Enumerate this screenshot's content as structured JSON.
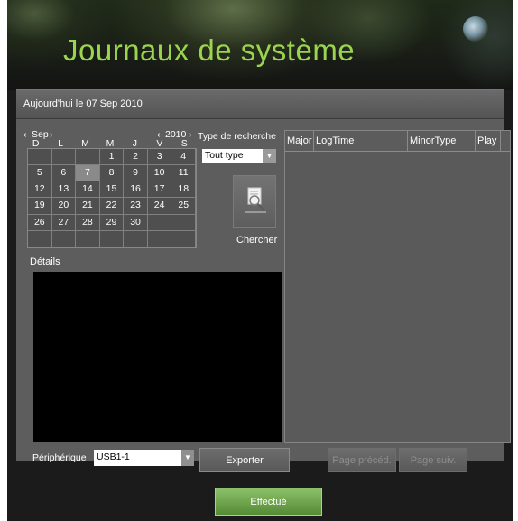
{
  "title": "Journaux de système",
  "date_bar": "Aujourd'hui le 07 Sep 2010",
  "calendar": {
    "month": "Sep",
    "year": "2010",
    "prev": "‹",
    "next": "›",
    "day_names": [
      "D",
      "L",
      "M",
      "M",
      "J",
      "V",
      "S"
    ],
    "weeks": [
      [
        "",
        "",
        "",
        "1",
        "2",
        "3",
        "4"
      ],
      [
        "5",
        "6",
        "7",
        "8",
        "9",
        "10",
        "11"
      ],
      [
        "12",
        "13",
        "14",
        "15",
        "16",
        "17",
        "18"
      ],
      [
        "19",
        "20",
        "21",
        "22",
        "23",
        "24",
        "25"
      ],
      [
        "26",
        "27",
        "28",
        "29",
        "30",
        "",
        ""
      ],
      [
        "",
        "",
        "",
        "",
        "",
        "",
        ""
      ]
    ],
    "selected_day": "7"
  },
  "search": {
    "type_label": "Type de recherche",
    "type_value": "Tout type",
    "button_label": "Chercher",
    "icon": "search-icon"
  },
  "details_label": "Détails",
  "log_table": {
    "columns": [
      "Major",
      "LogTime",
      "MinorType",
      "Play"
    ]
  },
  "device": {
    "label": "Périphérique",
    "value": "USB1-1"
  },
  "buttons": {
    "export": "Exporter",
    "prev_page": "Page précéd.",
    "next_page": "Page suiv.",
    "done": "Effectué"
  }
}
